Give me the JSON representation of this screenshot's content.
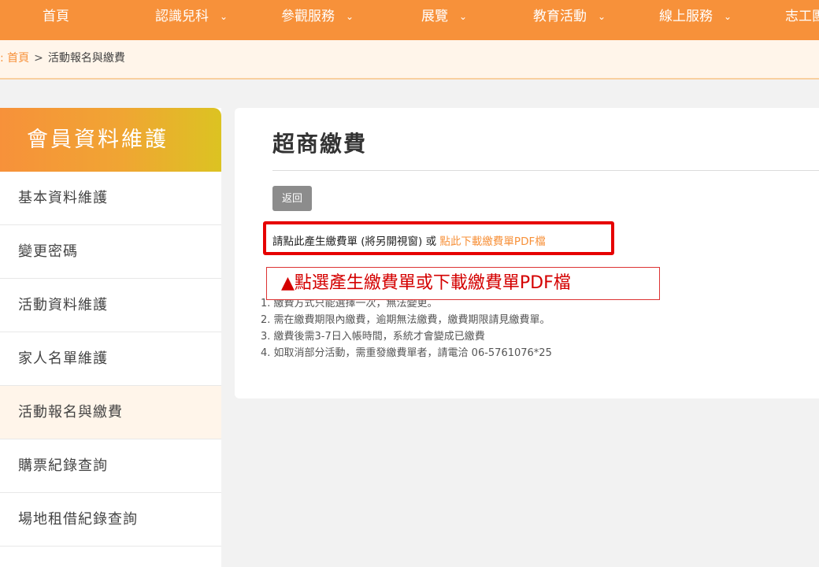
{
  "topnav": {
    "items": [
      {
        "label": "首頁",
        "dropdown": false
      },
      {
        "label": "認識兒科",
        "dropdown": true
      },
      {
        "label": "參觀服務",
        "dropdown": true
      },
      {
        "label": "展覽",
        "dropdown": true
      },
      {
        "label": "教育活動",
        "dropdown": true
      },
      {
        "label": "線上服務",
        "dropdown": true
      },
      {
        "label": "志工團",
        "dropdown": false
      }
    ],
    "chevron": "⌄"
  },
  "breadcrumb": {
    "prefix": ":",
    "home": "首頁",
    "separator": ">",
    "current": "活動報名與繳費"
  },
  "sidebar": {
    "title": "會員資料維護",
    "items": [
      {
        "label": "基本資料維護"
      },
      {
        "label": "變更密碼"
      },
      {
        "label": "活動資料維護"
      },
      {
        "label": "家人名單維護"
      },
      {
        "label": "活動報名與繳費"
      },
      {
        "label": "購票紀錄查詢"
      },
      {
        "label": "場地租借紀錄查詢"
      }
    ],
    "active_index": 4
  },
  "main": {
    "title": "超商繳費",
    "back_label": "返回",
    "instruction_text": "請點此產生繳費單 (將另開視窗) 或",
    "download_link": "點此下載繳費單PDF檔",
    "callout": "▲點選產生繳費單或下載繳費單PDF檔",
    "notes": [
      "1. 繳費方式只能選擇一次，無法變更。",
      "2. 需在繳費期限內繳費，逾期無法繳費，繳費期限請見繳費單。",
      "3. 繳費後需3-7日入帳時間，系統才會變成已繳費",
      "4. 如取消部分活動，需重發繳費單者，請電洽 06-5761076*25"
    ]
  },
  "colors": {
    "brand_orange": "#f7913a",
    "highlight_red": "#e60000",
    "breadcrumb_bg": "#fff5ea"
  }
}
